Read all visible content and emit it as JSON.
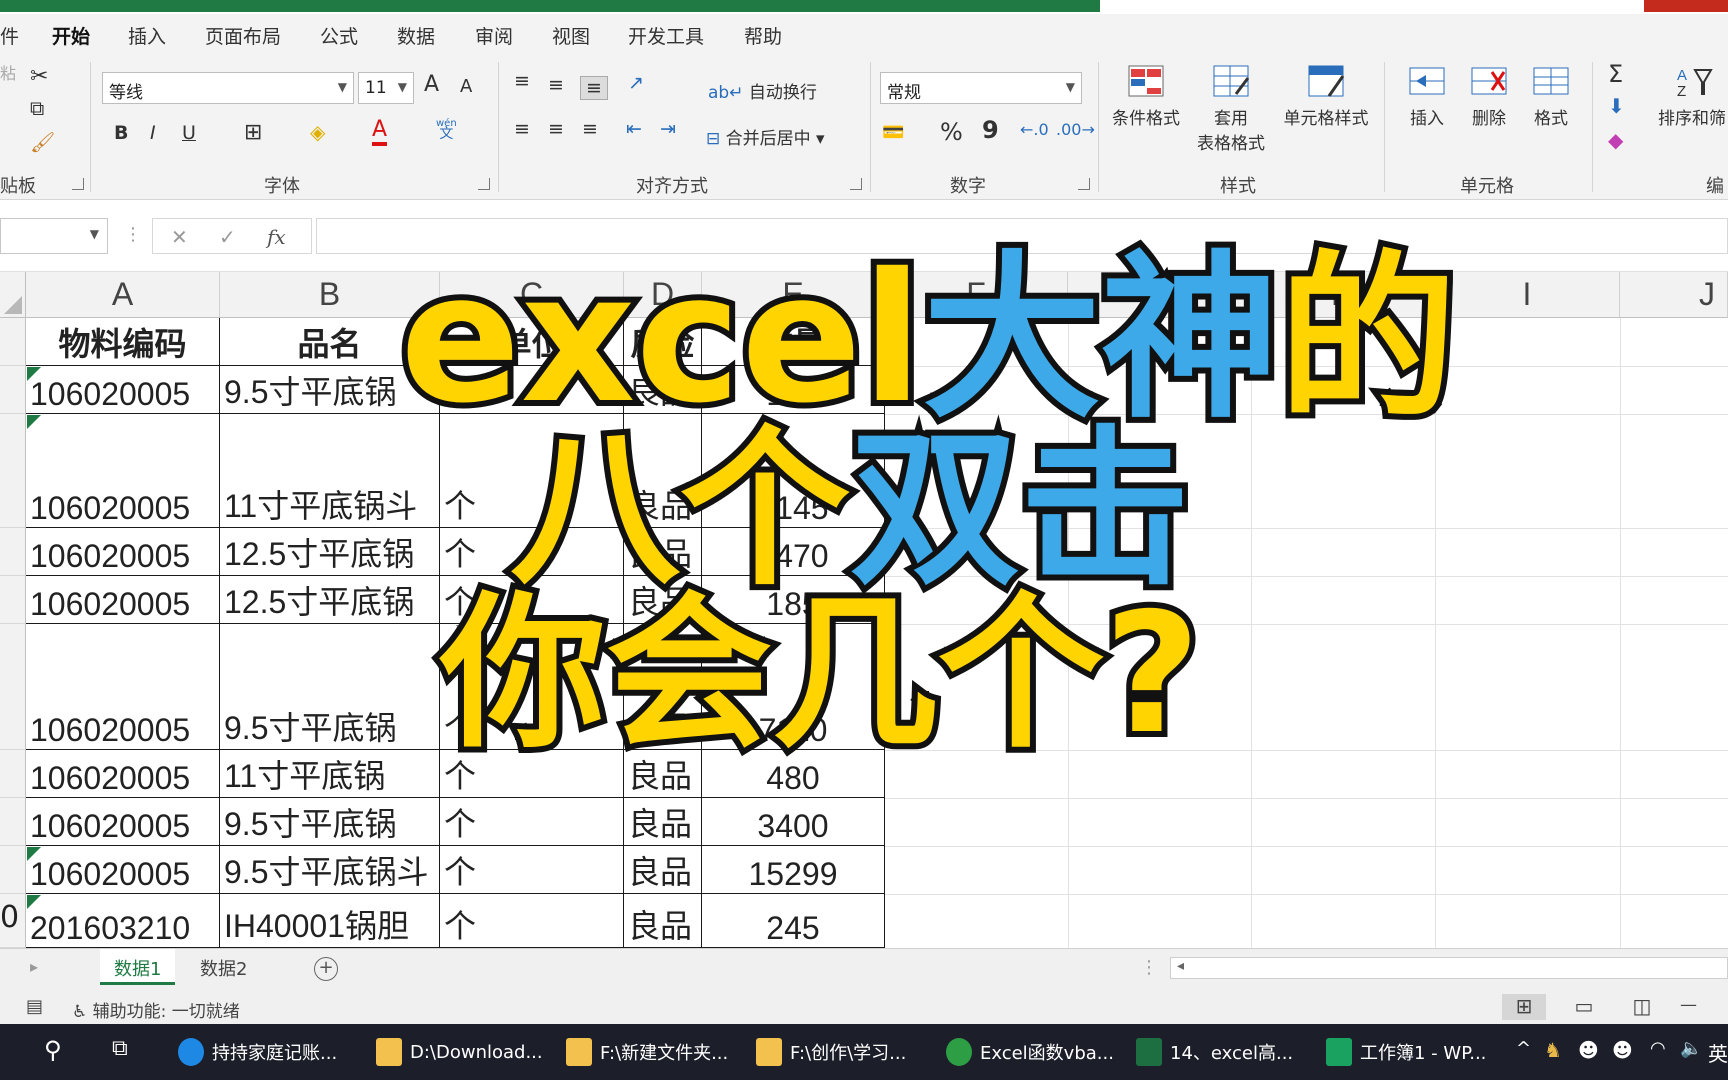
{
  "ribbon_tabs": [
    {
      "label": "件"
    },
    {
      "label": "开始"
    },
    {
      "label": "插入"
    },
    {
      "label": "页面布局"
    },
    {
      "label": "公式"
    },
    {
      "label": "数据"
    },
    {
      "label": "审阅"
    },
    {
      "label": "视图"
    },
    {
      "label": "开发工具"
    },
    {
      "label": "帮助"
    }
  ],
  "ribbon": {
    "clipboard_label": "贴板",
    "clipboard_paste_hint": "粘",
    "font_name": "等线",
    "font_size": "11",
    "font_label": "字体",
    "wrap_text": "自动换行",
    "merge_center": "合并后居中",
    "alignment_label": "对齐方式",
    "number_format": "常规",
    "number_label": "数字",
    "conditional_format": "条件格式",
    "table_format_line1": "套用",
    "table_format_line2": "表格格式",
    "cell_style": "单元格样式",
    "styles_label": "样式",
    "insert": "插入",
    "delete": "删除",
    "format": "格式",
    "cells_label": "单元格",
    "sort_filter": "排序和筛",
    "editing_label": "编",
    "grow_font": "A",
    "shrink_font": "A",
    "bold": "B",
    "italic": "I",
    "underline": "U",
    "phonetic_top": "wén",
    "phonetic_bottom": "文",
    "percent": "%",
    "comma": "9"
  },
  "formula_bar": {
    "fx": "fx",
    "cancel": "✕",
    "enter": "✓"
  },
  "columns": [
    "A",
    "B",
    "C",
    "D",
    "E",
    "F",
    "G",
    "H",
    "I",
    "J"
  ],
  "table": {
    "headers": [
      "物料编码",
      "品名",
      "单位",
      "质检",
      "数量"
    ],
    "rows": [
      [
        "106020005",
        "9.5寸平底锅",
        "个",
        "良品",
        "150"
      ],
      [
        "106020005",
        "11寸平底锅斗",
        "个",
        "良品",
        "3145"
      ],
      [
        "106020005",
        "12.5寸平底锅",
        "个",
        "良品",
        "8470"
      ],
      [
        "106020005",
        "12.5寸平底锅",
        "个",
        "良品",
        "185"
      ],
      [
        "106020005",
        "9.5寸平底锅",
        "个",
        "良品",
        "7110"
      ],
      [
        "106020005",
        "11寸平底锅",
        "个",
        "良品",
        "480"
      ],
      [
        "106020005",
        "9.5寸平底锅",
        "个",
        "良品",
        "3400"
      ],
      [
        "106020005",
        "9.5寸平底锅斗",
        "个",
        "良品",
        "15299"
      ],
      [
        "201603210",
        "IH40001锅胆",
        "个",
        "良品",
        "245"
      ]
    ],
    "row10_label": "0"
  },
  "sheets": [
    "数据1",
    "数据2"
  ],
  "status": {
    "accessibility": "辅助功能: 一切就绪",
    "zoom_minus": "—"
  },
  "taskbar": [
    {
      "label": "持持家庭记账...",
      "color": "#1e88e5"
    },
    {
      "label": "D:\\Download...",
      "color": "#f2c14e"
    },
    {
      "label": "F:\\新建文件夹...",
      "color": "#f2c14e"
    },
    {
      "label": "F:\\创作\\学习...",
      "color": "#f2c14e"
    },
    {
      "label": "Excel函数vba...",
      "color": "#2e9e44"
    },
    {
      "label": "14、excel高...",
      "color": "#1d6f42"
    },
    {
      "label": "工作簿1 - WP...",
      "color": "#1aa260"
    }
  ],
  "tray_ime": "英",
  "overlay": {
    "line1_a": "excel",
    "line1_b": "大神",
    "line1_c": "的",
    "line2_a": "八个",
    "line2_b": "双击",
    "line3": "你会几个?",
    "yellow": "#ffd400",
    "blue": "#3da9e8"
  }
}
